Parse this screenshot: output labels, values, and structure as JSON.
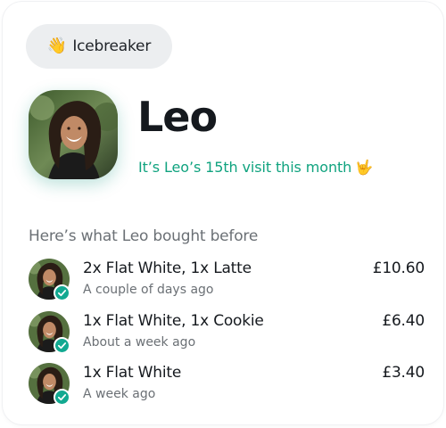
{
  "badge": {
    "emoji": "👋",
    "label": "Icebreaker",
    "icon": "waving-hand-icon"
  },
  "customer": {
    "name": "Leo",
    "visit_text": "It’s Leo’s 15th visit this month",
    "visit_emoji": "🤟"
  },
  "history": {
    "title": "Here’s what Leo bought before",
    "orders": [
      {
        "items": "2x Flat White, 1x Latte",
        "when": "A couple of days ago",
        "price": "£10.60"
      },
      {
        "items": "1x Flat White, 1x Cookie",
        "when": "About a week ago",
        "price": "£6.40"
      },
      {
        "items": "1x Flat White",
        "when": "A week ago",
        "price": "£3.40"
      }
    ]
  },
  "colors": {
    "accent": "#10a37f",
    "check": "#12a991",
    "pill_bg": "#eceef0",
    "muted": "#6b7075"
  }
}
